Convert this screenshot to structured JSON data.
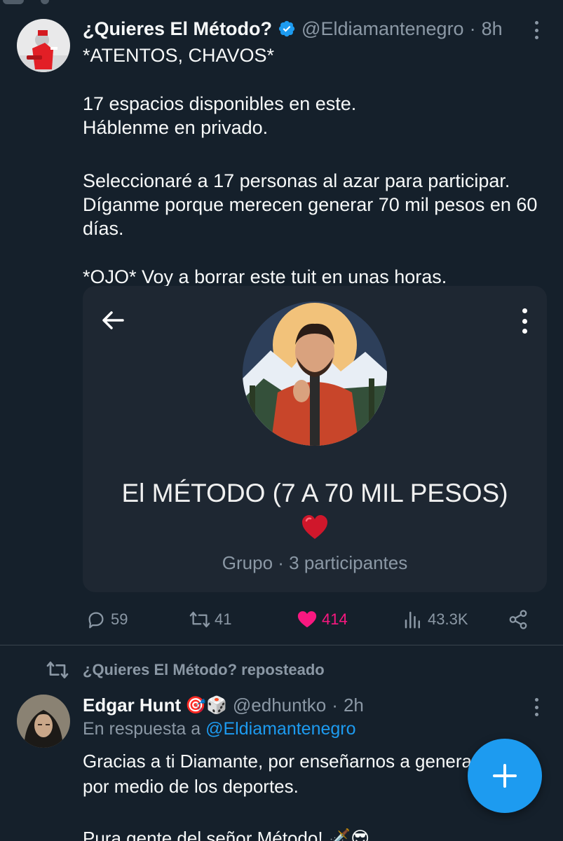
{
  "tweet1": {
    "display_name": "¿Quieres El Método?",
    "handle": "@Eldiamantenegro",
    "separator": "·",
    "time": "8h",
    "verified": true,
    "lines": [
      "*ATENTOS, CHAVOS*",
      "",
      "17 espacios disponibles en este.",
      "Háblenme en privado.",
      "",
      "Seleccionaré a 17 personas al azar para participar.",
      "Díganme porque merecen generar 70 mil pesos en 60",
      "días.",
      "",
      "*OJO* Voy a borrar este tuit en unas horas."
    ],
    "card": {
      "group_name": "El MÉTODO (7 A 70 MIL PESOS)",
      "emoji": "❤️",
      "subtitle": "Grupo · 3 participantes"
    },
    "actions": {
      "replies": "59",
      "retweets": "41",
      "likes": "414",
      "views": "43.3K"
    }
  },
  "repost_banner": "¿Quieres El Método? reposteado",
  "tweet2": {
    "display_name": "Edgar Hunt",
    "name_emojis": "🎯🎲",
    "handle": "@edhuntko",
    "separator": "·",
    "time": "2h",
    "reply_prefix": "En respuesta a",
    "reply_handle": "@Eldiamantenegro",
    "line1": "Gracias a ti Diamante, por enseñarnos a generar",
    "line2": "por medio de los deportes.",
    "line3": "Pura gente del señor Método! 🗡️😎"
  },
  "colors": {
    "background": "#15202b",
    "accent": "#1d9bf0",
    "like": "#f91880",
    "muted": "#8b98a5"
  }
}
